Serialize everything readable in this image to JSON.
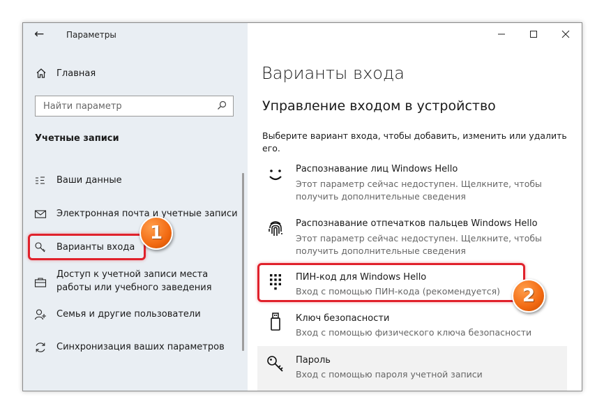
{
  "window": {
    "title": "Параметры"
  },
  "sidebar": {
    "home_label": "Главная",
    "search_placeholder": "Найти параметр",
    "section_title": "Учетные записи",
    "items": [
      {
        "label": "Ваши данные",
        "icon": "user-card-icon"
      },
      {
        "label": "Электронная почта и учетные записи",
        "icon": "mail-icon"
      },
      {
        "label": "Варианты входа",
        "icon": "key-icon"
      },
      {
        "label": "Доступ к учетной записи места работы или учебного заведения",
        "icon": "briefcase-icon"
      },
      {
        "label": "Семья и другие пользователи",
        "icon": "add-user-icon"
      },
      {
        "label": "Синхронизация ваших параметров",
        "icon": "sync-icon"
      }
    ]
  },
  "main": {
    "title": "Варианты входа",
    "subtitle": "Управление входом в устройство",
    "description": "Выберите вариант входа, чтобы добавить, изменить или удалить его.",
    "options": [
      {
        "title": "Распознавание лиц Windows Hello",
        "desc": "Этот параметр сейчас недоступен. Щелкните, чтобы получить дополнительные сведения",
        "icon": "face-smile-icon"
      },
      {
        "title": "Распознавание отпечатков пальцев Windows Hello",
        "desc": "Этот параметр сейчас недоступен. Щелкните, чтобы получить дополнительные сведения",
        "icon": "fingerprint-icon"
      },
      {
        "title": "ПИН-код для Windows Hello",
        "desc": "Вход с помощью ПИН-кода (рекомендуется)",
        "icon": "pin-keypad-icon"
      },
      {
        "title": "Ключ безопасности",
        "desc": "Вход с помощью физического ключа безопасности",
        "icon": "usb-key-icon"
      },
      {
        "title": "Пароль",
        "desc": "Вход с помощью пароля учетной записи",
        "icon": "password-key-icon"
      }
    ]
  },
  "annotations": {
    "badge1": "1",
    "badge2": "2",
    "color": "#e0212b",
    "badge_color": "#f26a12"
  }
}
